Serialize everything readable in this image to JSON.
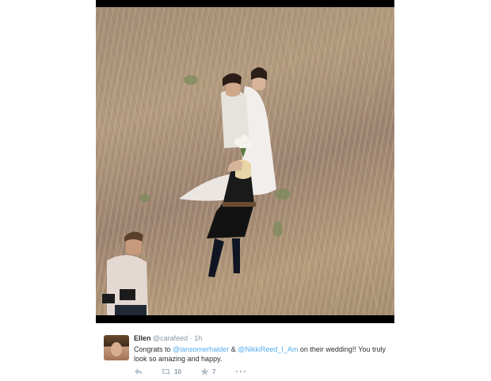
{
  "tweet": {
    "author_name": "Ellen",
    "author_handle": "@carafeed",
    "separator": " · ",
    "time": "1h",
    "text_1": "Congrats to ",
    "mention_1": "@iansomerhalder",
    "text_2": " & ",
    "mention_2": "@NikkiReed_I_Am",
    "text_3": " on their wedding!! You truly look so amazing and happy.",
    "retweet_count": "10",
    "favorite_count": "7"
  },
  "colors": {
    "link": "#55acee",
    "muted": "#8899a6",
    "text": "#292f33"
  },
  "icons": [
    "reply-icon",
    "retweet-icon",
    "favorite-star-icon",
    "more-icon"
  ]
}
